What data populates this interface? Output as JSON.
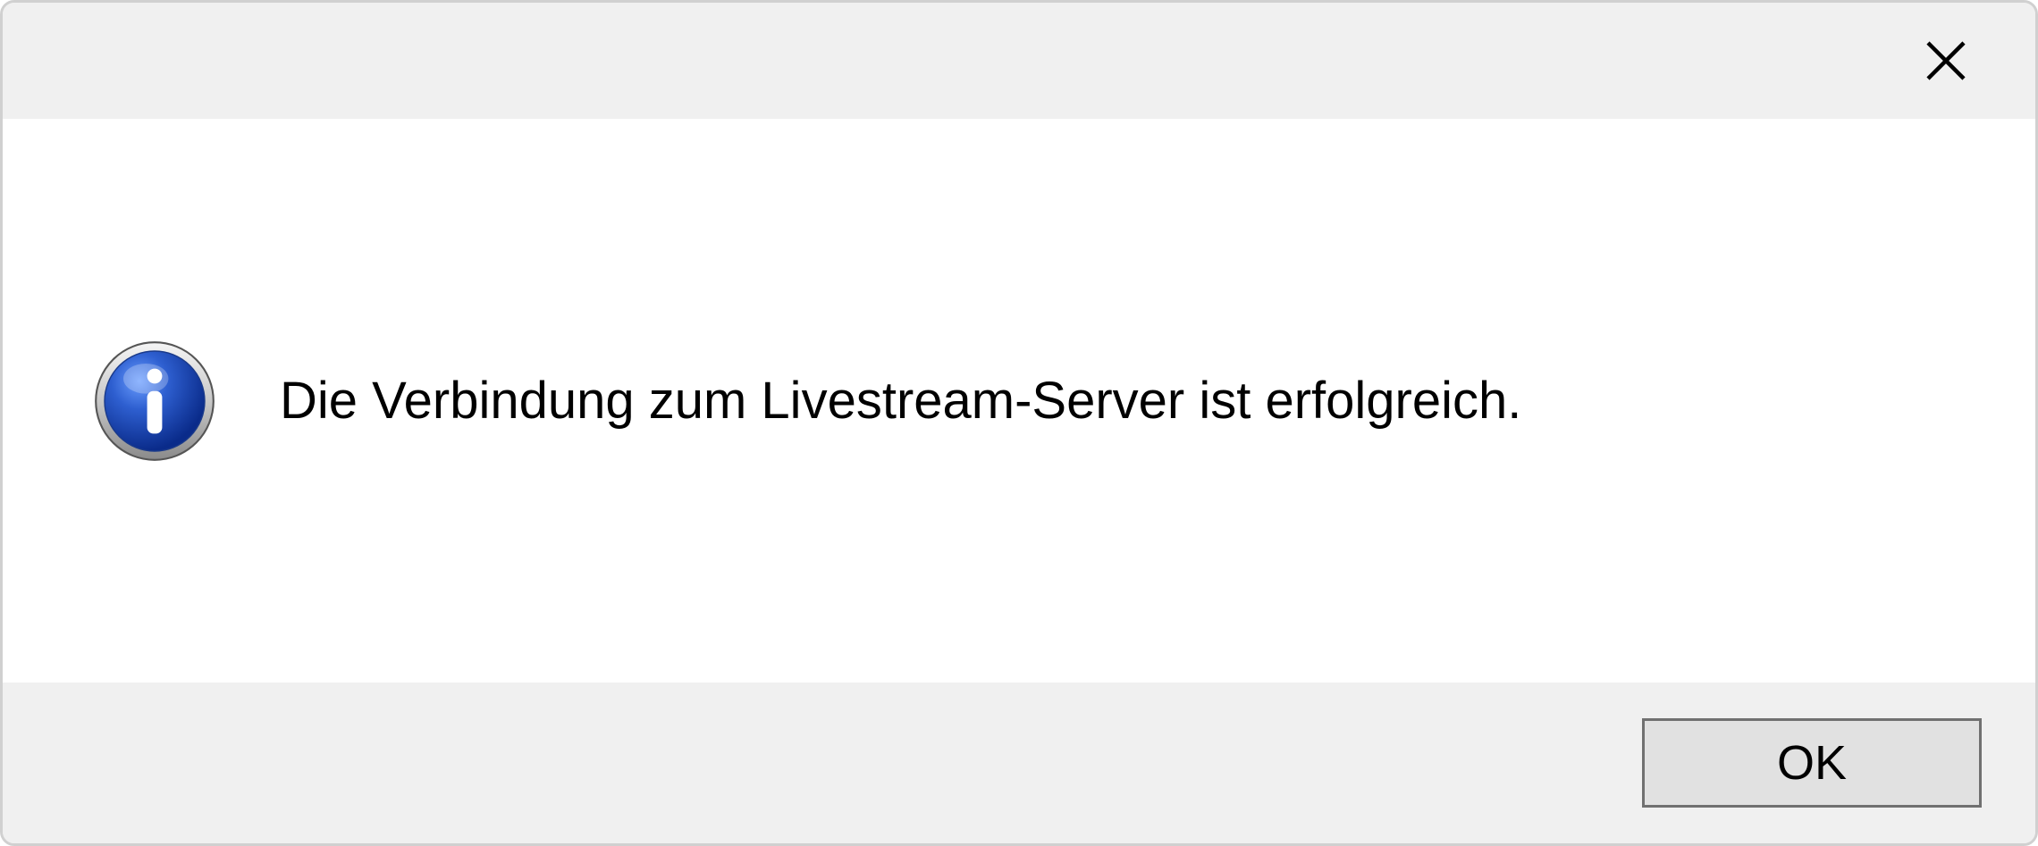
{
  "dialog": {
    "message": "Die Verbindung zum Livestream-Server ist erfolgreich.",
    "ok_label": "OK"
  }
}
